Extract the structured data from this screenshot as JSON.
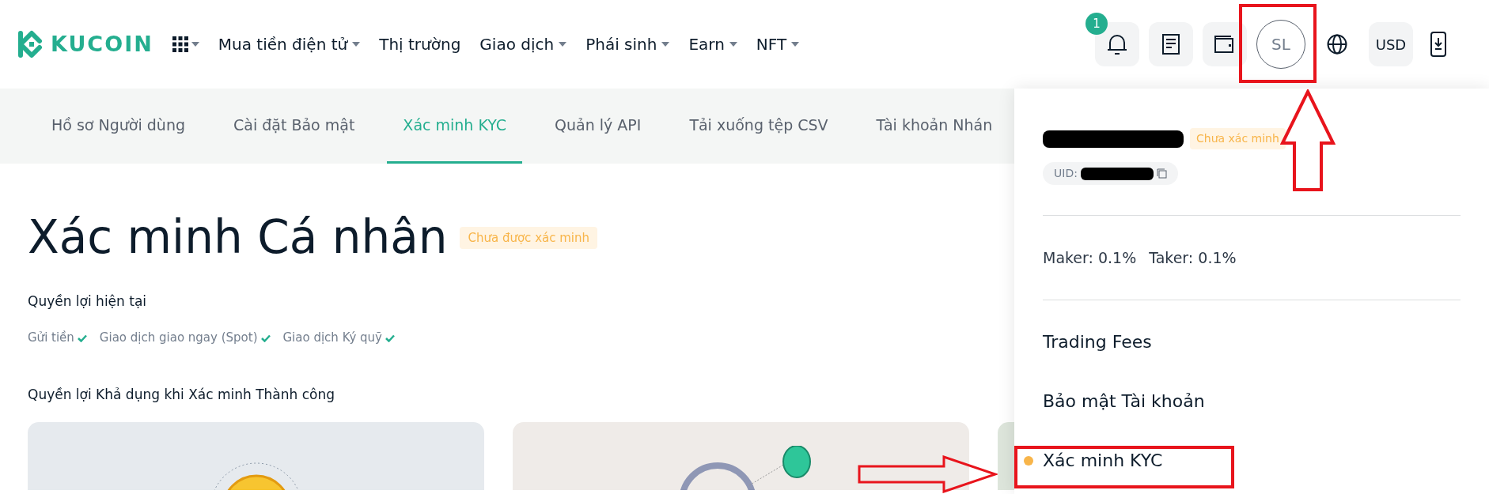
{
  "header": {
    "logo_text": "KUCOIN",
    "nav": [
      {
        "label": "Mua tiền điện tử",
        "dropdown": true
      },
      {
        "label": "Thị trường",
        "dropdown": false
      },
      {
        "label": "Giao dịch",
        "dropdown": true
      },
      {
        "label": "Phái sinh",
        "dropdown": true
      },
      {
        "label": "Earn",
        "dropdown": true
      },
      {
        "label": "NFT",
        "dropdown": true
      }
    ],
    "notification_count": "1",
    "avatar": "SL",
    "currency": "USD"
  },
  "tabs": [
    {
      "label": "Hồ sơ Người dùng",
      "selected": false
    },
    {
      "label": "Cài đặt Bảo mật",
      "selected": false
    },
    {
      "label": "Xác minh KYC",
      "selected": true
    },
    {
      "label": "Quản lý API",
      "selected": false
    },
    {
      "label": "Tải xuống tệp CSV",
      "selected": false
    },
    {
      "label": "Tài khoản Nhán",
      "selected": false
    }
  ],
  "page": {
    "title": "Xác minh Cá nhân",
    "status_badge": "Chưa được xác minh",
    "current_benefits_title": "Quyền lợi hiện tại",
    "current_benefits": [
      {
        "label": "Gửi tiền",
        "checked": true
      },
      {
        "label": "Giao dịch giao ngay (Spot)",
        "checked": true
      },
      {
        "label": "Giao dịch Ký quỹ",
        "checked": true
      }
    ],
    "available_benefits_title": "Quyền lợi Khả dụng khi Xác minh Thành công"
  },
  "account_menu": {
    "status_badge": "Chưa xác minh",
    "uid_label": "UID:",
    "maker_fee": "Maker: 0.1%",
    "taker_fee": "Taker: 0.1%",
    "items": [
      {
        "label": "Trading Fees"
      },
      {
        "label": "Bảo mật Tài khoản"
      },
      {
        "label": "Xác minh KYC",
        "color": "#f8b54a"
      }
    ]
  }
}
